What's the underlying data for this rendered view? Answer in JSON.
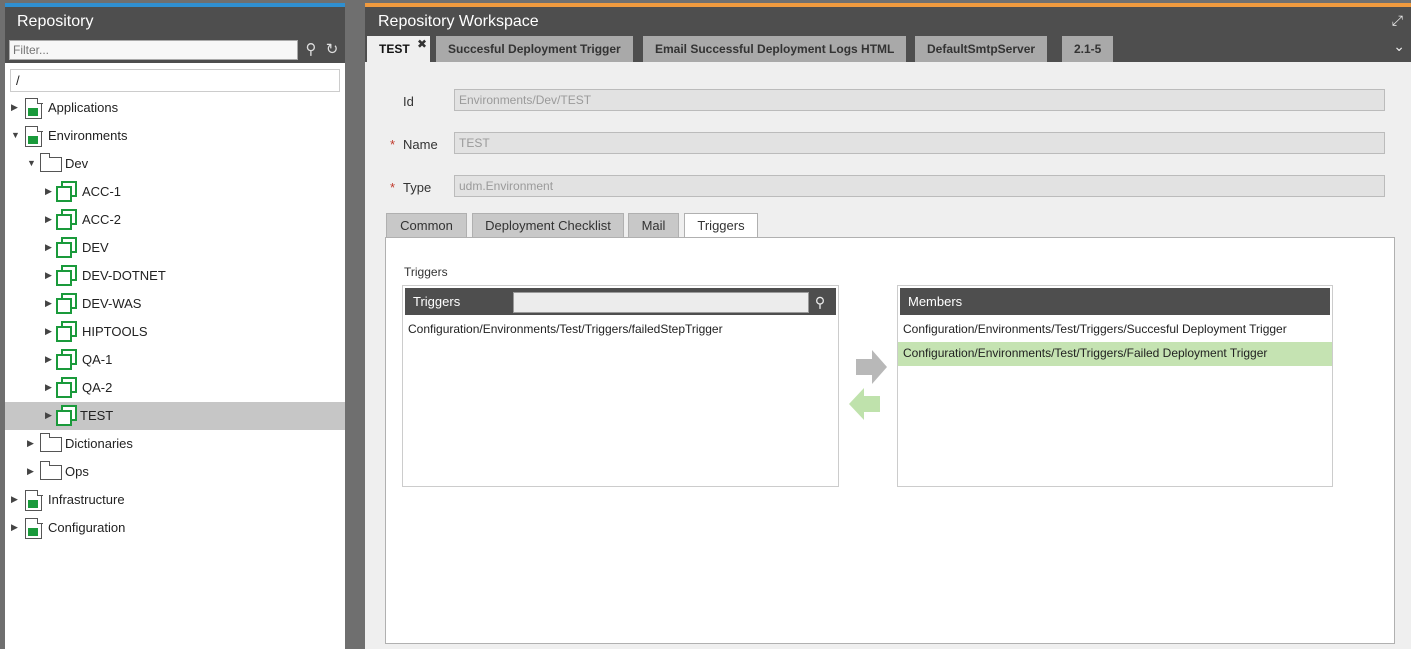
{
  "repository": {
    "title": "Repository",
    "filter_placeholder": "Filter...",
    "path": "/",
    "tree": [
      {
        "label": "Applications",
        "icon": "document-icon",
        "toggle": "▶"
      },
      {
        "label": "Environments",
        "icon": "document-icon",
        "toggle": "▼"
      },
      {
        "label": "Dev",
        "icon": "folder-icon",
        "toggle": "▼"
      },
      {
        "label": "ACC-1",
        "icon": "environment-icon",
        "toggle": "▶"
      },
      {
        "label": "ACC-2",
        "icon": "environment-icon",
        "toggle": "▶"
      },
      {
        "label": "DEV",
        "icon": "environment-icon",
        "toggle": "▶"
      },
      {
        "label": "DEV-DOTNET",
        "icon": "environment-icon",
        "toggle": "▶"
      },
      {
        "label": "DEV-WAS",
        "icon": "environment-icon",
        "toggle": "▶"
      },
      {
        "label": "HIPTOOLS",
        "icon": "environment-icon",
        "toggle": "▶"
      },
      {
        "label": "QA-1",
        "icon": "environment-icon",
        "toggle": "▶"
      },
      {
        "label": "QA-2",
        "icon": "environment-icon",
        "toggle": "▶"
      },
      {
        "label": "TEST",
        "icon": "environment-icon",
        "toggle": "▶",
        "selected": true
      },
      {
        "label": "Dictionaries",
        "icon": "folder-icon",
        "toggle": "▶"
      },
      {
        "label": "Ops",
        "icon": "folder-icon",
        "toggle": "▶"
      },
      {
        "label": "Infrastructure",
        "icon": "document-icon",
        "toggle": "▶"
      },
      {
        "label": "Configuration",
        "icon": "document-icon",
        "toggle": "▶"
      }
    ]
  },
  "workspace": {
    "title": "Repository Workspace",
    "tabs": [
      {
        "label": "TEST",
        "active": true,
        "closable": true
      },
      {
        "label": "Succesful Deployment Trigger"
      },
      {
        "label": "Email Successful Deployment Logs HTML"
      },
      {
        "label": "DefaultSmtpServer"
      },
      {
        "label": "2.1-5"
      }
    ],
    "fields": {
      "id": {
        "label": "Id",
        "value": "Environments/Dev/TEST"
      },
      "name": {
        "label": "Name",
        "value": "TEST",
        "required": "*"
      },
      "type": {
        "label": "Type",
        "value": "udm.Environment",
        "required": "*"
      }
    },
    "subtabs": [
      "Common",
      "Deployment Checklist",
      "Mail",
      "Triggers"
    ],
    "active_subtab": "Triggers",
    "triggers_section": {
      "label": "Triggers",
      "available": {
        "header": "Triggers",
        "items": [
          "Configuration/Environments/Test/Triggers/failedStepTrigger"
        ]
      },
      "members": {
        "header": "Members",
        "items": [
          "Configuration/Environments/Test/Triggers/Succesful Deployment Trigger",
          "Configuration/Environments/Test/Triggers/Failed Deployment Trigger"
        ],
        "selected_index": 1
      }
    }
  },
  "colors": {
    "accent_left": "#2f8fd0",
    "accent_right": "#f09a3e",
    "selected_member": "#c5e3b2",
    "icon_green": "#1a9a3b"
  }
}
